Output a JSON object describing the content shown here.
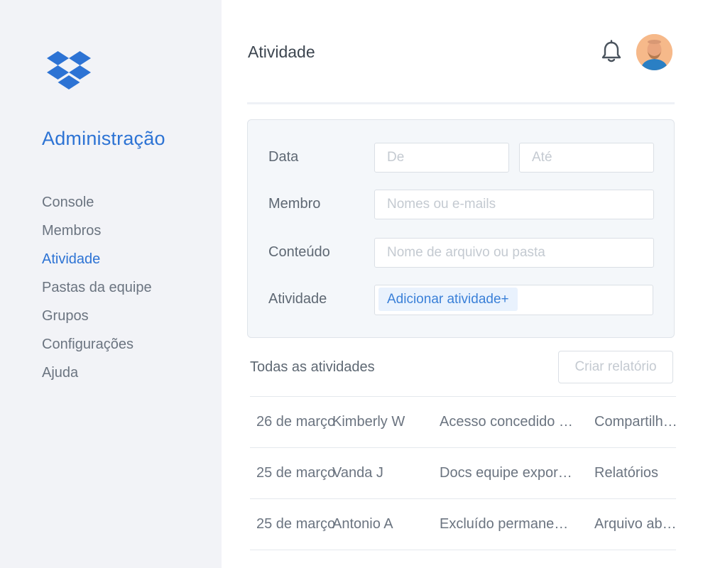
{
  "sidebar": {
    "logo_icon": "dropbox-logo-icon",
    "title": "Administração",
    "items": [
      {
        "label": "Console",
        "active": false
      },
      {
        "label": "Membros",
        "active": false
      },
      {
        "label": "Atividade",
        "active": true
      },
      {
        "label": "Pastas da equipe",
        "active": false
      },
      {
        "label": "Grupos",
        "active": false
      },
      {
        "label": "Configurações",
        "active": false
      },
      {
        "label": "Ajuda",
        "active": false
      }
    ]
  },
  "header": {
    "title": "Atividade",
    "bell_icon": "bell-icon",
    "avatar_icon": "user-avatar"
  },
  "filters": {
    "date": {
      "label": "Data",
      "from_placeholder": "De",
      "to_placeholder": "Até"
    },
    "member": {
      "label": "Membro",
      "placeholder": "Nomes ou e-mails"
    },
    "content": {
      "label": "Conteúdo",
      "placeholder": "Nome de arquivo ou pasta"
    },
    "activity": {
      "label": "Atividade",
      "chip": "Adicionar atividade+"
    }
  },
  "results": {
    "title": "Todas as atividades",
    "report_button": "Criar relatório",
    "rows": [
      {
        "date": "26 de março",
        "member": "Kimberly W",
        "action": "Acesso concedido a pasta",
        "type": "Compartilhamento"
      },
      {
        "date": "25 de março",
        "member": "Vanda J",
        "action": "Docs equipe exportados",
        "type": "Relatórios"
      },
      {
        "date": "25 de março",
        "member": "Antonio A",
        "action": "Excluído permanentemente",
        "type": "Arquivo aberto"
      }
    ]
  },
  "colors": {
    "accent": "#2d73d4",
    "sidebar_bg": "#f2f3f7",
    "filter_bg": "#f4f7fa"
  }
}
